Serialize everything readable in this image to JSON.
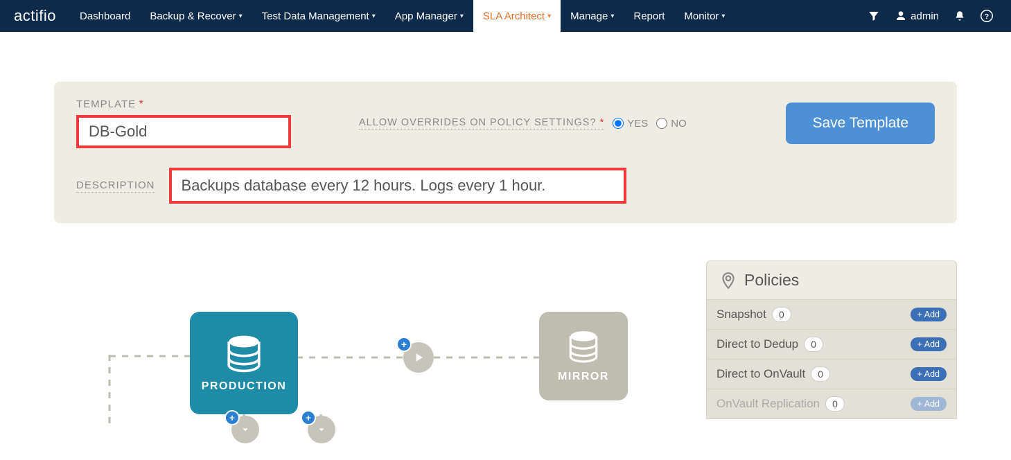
{
  "brand": "actifio",
  "nav": [
    {
      "label": "Dashboard",
      "caret": false
    },
    {
      "label": "Backup & Recover",
      "caret": true
    },
    {
      "label": "Test Data Management",
      "caret": true
    },
    {
      "label": "App Manager",
      "caret": true
    },
    {
      "label": "SLA Architect",
      "caret": true,
      "active": true
    },
    {
      "label": "Manage",
      "caret": true
    },
    {
      "label": "Report",
      "caret": false
    },
    {
      "label": "Monitor",
      "caret": true
    }
  ],
  "user": "admin",
  "form": {
    "template_label": "TEMPLATE",
    "template_value": "DB-Gold",
    "override_label": "ALLOW OVERRIDES ON POLICY SETTINGS?",
    "yes": "YES",
    "no": "NO",
    "save_label": "Save Template",
    "desc_label": "DESCRIPTION",
    "desc_value": "Backups database every 12 hours. Logs every 1 hour."
  },
  "policies": {
    "title": "Policies",
    "add_label": "+ Add",
    "rows": [
      {
        "name": "Snapshot",
        "count": "0"
      },
      {
        "name": "Direct to Dedup",
        "count": "0"
      },
      {
        "name": "Direct to OnVault",
        "count": "0"
      },
      {
        "name": "OnVault Replication",
        "count": "0",
        "disabled": true
      }
    ]
  },
  "diagram": {
    "production": "PRODUCTION",
    "mirror": "MIRROR"
  }
}
